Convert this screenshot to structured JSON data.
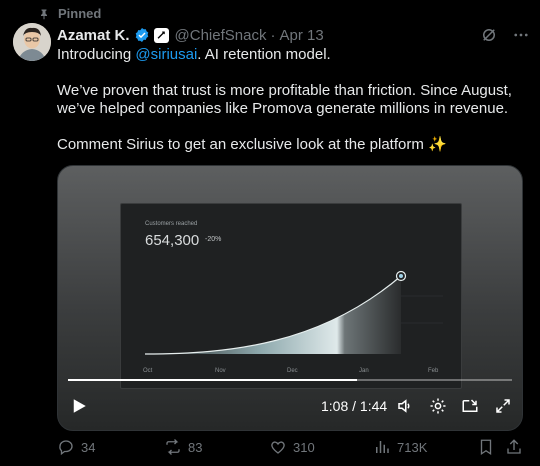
{
  "pinned_label": "Pinned",
  "author": {
    "name": "Azamat K.",
    "handle": "@ChiefSnack",
    "separator": "·",
    "date": "Apr 13"
  },
  "body": {
    "line1_prefix": "Introducing ",
    "line1_mention": "@siriusai",
    "line1_suffix": ". AI retention model.",
    "para2": "We’ve proven that trust is more profitable than friction. Since August, we’ve helped companies like Promova generate millions in revenue.",
    "para3": "Comment Sirius to get an exclusive look at the platform ✨"
  },
  "video": {
    "inner_label": "Customers reached",
    "inner_value": "654,300",
    "inner_change": "-20%",
    "x_ticks": [
      "Oct",
      "Nov",
      "Dec",
      "Jan",
      "Feb"
    ],
    "progress": 0.65,
    "time_readout": "1:08 / 1:44"
  },
  "actions": {
    "replies": "34",
    "reposts": "83",
    "likes": "310",
    "views": "713K"
  },
  "colors": {
    "accent": "#1d9bf0",
    "muted": "#71767b",
    "text": "#e7e9ea"
  }
}
